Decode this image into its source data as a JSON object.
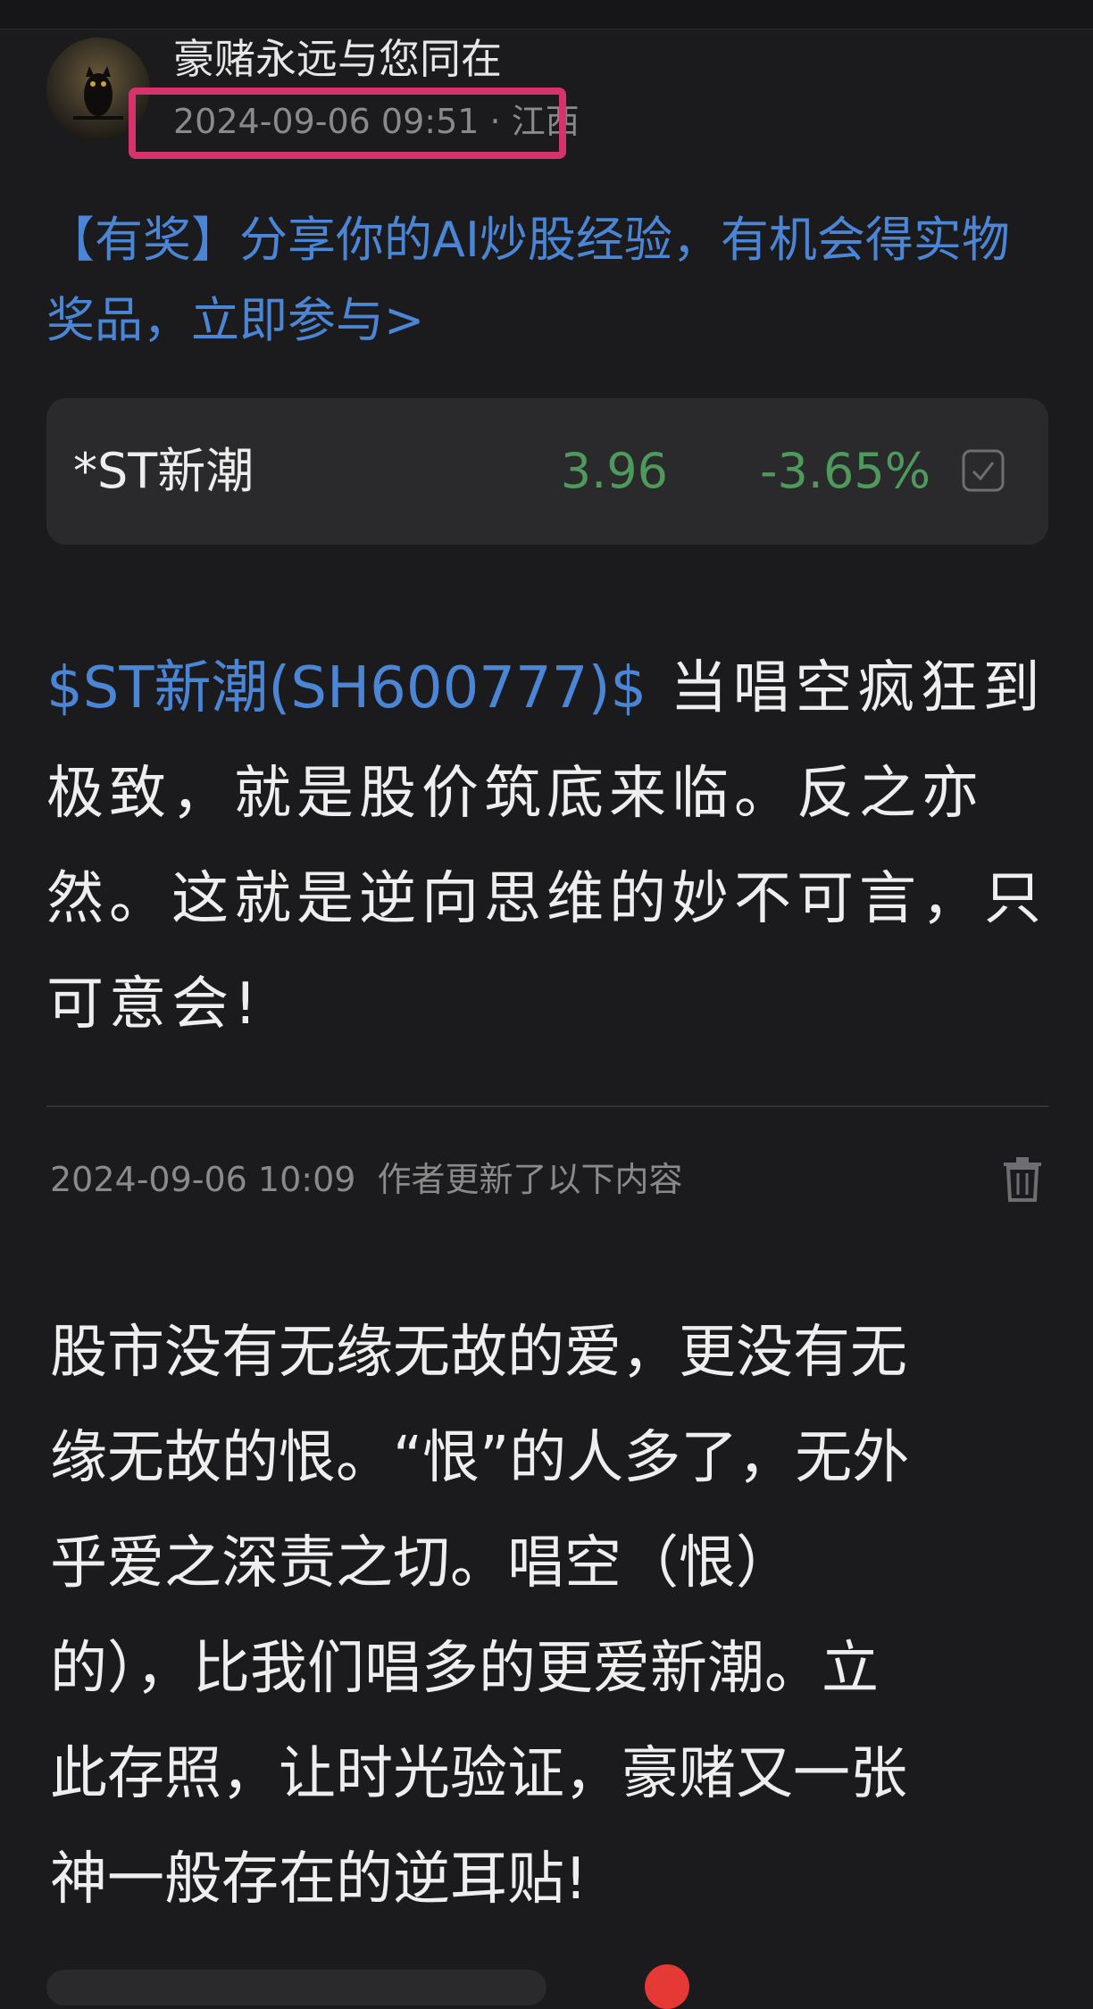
{
  "post": {
    "author_name": "豪赌永远与您同在",
    "timestamp": "2024-09-06 09:51",
    "separator": "·",
    "location": "江西"
  },
  "promo": {
    "text": "【有奖】分享你的AI炒股经验，有机会得实物奖品，立即参与>"
  },
  "stock_card": {
    "name": "*ST新潮",
    "price": "3.96",
    "change": "-3.65%",
    "color_down_green": "#4e9a5c",
    "icon": "checkbox-icon"
  },
  "content": {
    "tag": "$ST新潮(SH600777)$",
    "text": "当唱空疯狂到极致，就是股价筑底来临。反之亦然。这就是逆向思维的妙不可言，只可意会!"
  },
  "update": {
    "timestamp": "2024-09-06 10:09",
    "label": "作者更新了以下内容",
    "icon": "trash-icon",
    "text": "股市没有无缘无故的爱，更没有无\n缘无故的恨。“恨”的人多了，无外\n乎爱之深责之切。唱空（恨）\n的），比我们唱多的更爱新潮。立\n此存照，让时光验证，豪赌又一张\n神一般存在的逆耳贴!"
  },
  "colors": {
    "background": "#1b1b1d",
    "link_blue": "#4b86d6",
    "highlight_pink": "#d6336c"
  }
}
